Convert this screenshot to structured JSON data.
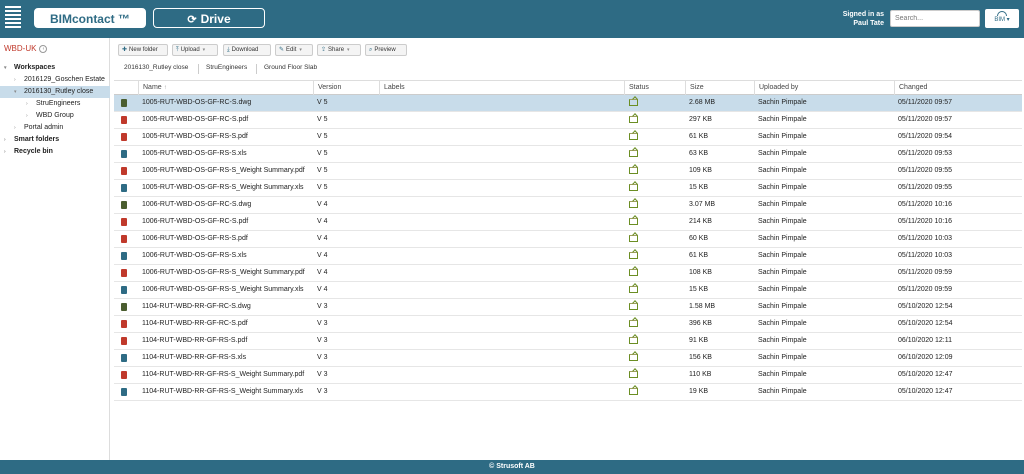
{
  "header": {
    "app_title": "BIMcontact ™",
    "drive_label": "Drive",
    "signed_in_label": "Signed in as",
    "user_name": "Paul Tate",
    "search_placeholder": "Search...",
    "bim_menu_label": "BIM",
    "bar_color": "#2e6b84"
  },
  "sidebar": {
    "org": "WBD-UK",
    "items": [
      {
        "label": "Workspaces",
        "level": 0,
        "bold": true,
        "expanded": true
      },
      {
        "label": "2016129_Goschen Estate",
        "level": 1,
        "bold": false
      },
      {
        "label": "2016130_Rutley close",
        "level": 1,
        "bold": false,
        "selected": true,
        "expanded": true
      },
      {
        "label": "StruEngineers",
        "level": 2,
        "bold": false
      },
      {
        "label": "WBD Group",
        "level": 2,
        "bold": false
      },
      {
        "label": "Portal admin",
        "level": 1,
        "bold": false
      },
      {
        "label": "Smart folders",
        "level": 0,
        "bold": true
      },
      {
        "label": "Recycle bin",
        "level": 0,
        "bold": true
      }
    ]
  },
  "toolbar": {
    "new_folder": "New folder",
    "upload": "Upload",
    "download": "Download",
    "edit": "Edit",
    "share": "Share",
    "preview": "Preview"
  },
  "breadcrumb": [
    "2016130_Rutley close",
    "StruEngineers",
    "Ground Floor Slab"
  ],
  "table": {
    "columns": {
      "name": "Name",
      "version": "Version",
      "labels": "Labels",
      "status": "Status",
      "size": "Size",
      "uploaded_by": "Uploaded by",
      "changed": "Changed"
    },
    "rows": [
      {
        "type": "dwg",
        "name": "1005-RUT-WBD-OS-GF-RC-S.dwg",
        "version": "V 5",
        "size": "2.68 MB",
        "uploaded_by": "Sachin Pimpale",
        "changed": "05/11/2020 09:57",
        "selected": true
      },
      {
        "type": "pdf",
        "name": "1005-RUT-WBD-OS-GF-RC-S.pdf",
        "version": "V 5",
        "size": "297 KB",
        "uploaded_by": "Sachin Pimpale",
        "changed": "05/11/2020 09:57"
      },
      {
        "type": "pdf",
        "name": "1005-RUT-WBD-OS-GF-RS-S.pdf",
        "version": "V 5",
        "size": "61 KB",
        "uploaded_by": "Sachin Pimpale",
        "changed": "05/11/2020 09:54"
      },
      {
        "type": "xls",
        "name": "1005-RUT-WBD-OS-GF-RS-S.xls",
        "version": "V 5",
        "size": "63 KB",
        "uploaded_by": "Sachin Pimpale",
        "changed": "05/11/2020 09:53"
      },
      {
        "type": "pdf",
        "name": "1005-RUT-WBD-OS-GF-RS-S_Weight Summary.pdf",
        "version": "V 5",
        "size": "109 KB",
        "uploaded_by": "Sachin Pimpale",
        "changed": "05/11/2020 09:55"
      },
      {
        "type": "xls",
        "name": "1005-RUT-WBD-OS-GF-RS-S_Weight Summary.xls",
        "version": "V 5",
        "size": "15 KB",
        "uploaded_by": "Sachin Pimpale",
        "changed": "05/11/2020 09:55"
      },
      {
        "type": "dwg",
        "name": "1006-RUT-WBD-OS-GF-RC-S.dwg",
        "version": "V 4",
        "size": "3.07 MB",
        "uploaded_by": "Sachin Pimpale",
        "changed": "05/11/2020 10:16"
      },
      {
        "type": "pdf",
        "name": "1006-RUT-WBD-OS-GF-RC-S.pdf",
        "version": "V 4",
        "size": "214 KB",
        "uploaded_by": "Sachin Pimpale",
        "changed": "05/11/2020 10:16"
      },
      {
        "type": "pdf",
        "name": "1006-RUT-WBD-OS-GF-RS-S.pdf",
        "version": "V 4",
        "size": "60 KB",
        "uploaded_by": "Sachin Pimpale",
        "changed": "05/11/2020 10:03"
      },
      {
        "type": "xls",
        "name": "1006-RUT-WBD-OS-GF-RS-S.xls",
        "version": "V 4",
        "size": "61 KB",
        "uploaded_by": "Sachin Pimpale",
        "changed": "05/11/2020 10:03"
      },
      {
        "type": "pdf",
        "name": "1006-RUT-WBD-OS-GF-RS-S_Weight Summary.pdf",
        "version": "V 4",
        "size": "108 KB",
        "uploaded_by": "Sachin Pimpale",
        "changed": "05/11/2020 09:59"
      },
      {
        "type": "xls",
        "name": "1006-RUT-WBD-OS-GF-RS-S_Weight Summary.xls",
        "version": "V 4",
        "size": "15 KB",
        "uploaded_by": "Sachin Pimpale",
        "changed": "05/11/2020 09:59"
      },
      {
        "type": "dwg",
        "name": "1104-RUT-WBD-RR-GF-RC-S.dwg",
        "version": "V 3",
        "size": "1.58 MB",
        "uploaded_by": "Sachin Pimpale",
        "changed": "05/10/2020 12:54"
      },
      {
        "type": "pdf",
        "name": "1104-RUT-WBD-RR-GF-RC-S.pdf",
        "version": "V 3",
        "size": "396 KB",
        "uploaded_by": "Sachin Pimpale",
        "changed": "05/10/2020 12:54"
      },
      {
        "type": "pdf",
        "name": "1104-RUT-WBD-RR-GF-RS-S.pdf",
        "version": "V 3",
        "size": "91 KB",
        "uploaded_by": "Sachin Pimpale",
        "changed": "06/10/2020 12:11"
      },
      {
        "type": "xls",
        "name": "1104-RUT-WBD-RR-GF-RS-S.xls",
        "version": "V 3",
        "size": "156 KB",
        "uploaded_by": "Sachin Pimpale",
        "changed": "06/10/2020 12:09"
      },
      {
        "type": "pdf",
        "name": "1104-RUT-WBD-RR-GF-RS-S_Weight Summary.pdf",
        "version": "V 3",
        "size": "110 KB",
        "uploaded_by": "Sachin Pimpale",
        "changed": "05/10/2020 12:47"
      },
      {
        "type": "xls",
        "name": "1104-RUT-WBD-RR-GF-RS-S_Weight Summary.xls",
        "version": "V 3",
        "size": "19 KB",
        "uploaded_by": "Sachin Pimpale",
        "changed": "05/10/2020 12:47"
      }
    ]
  },
  "footer": {
    "copyright": "© Strusoft AB"
  }
}
